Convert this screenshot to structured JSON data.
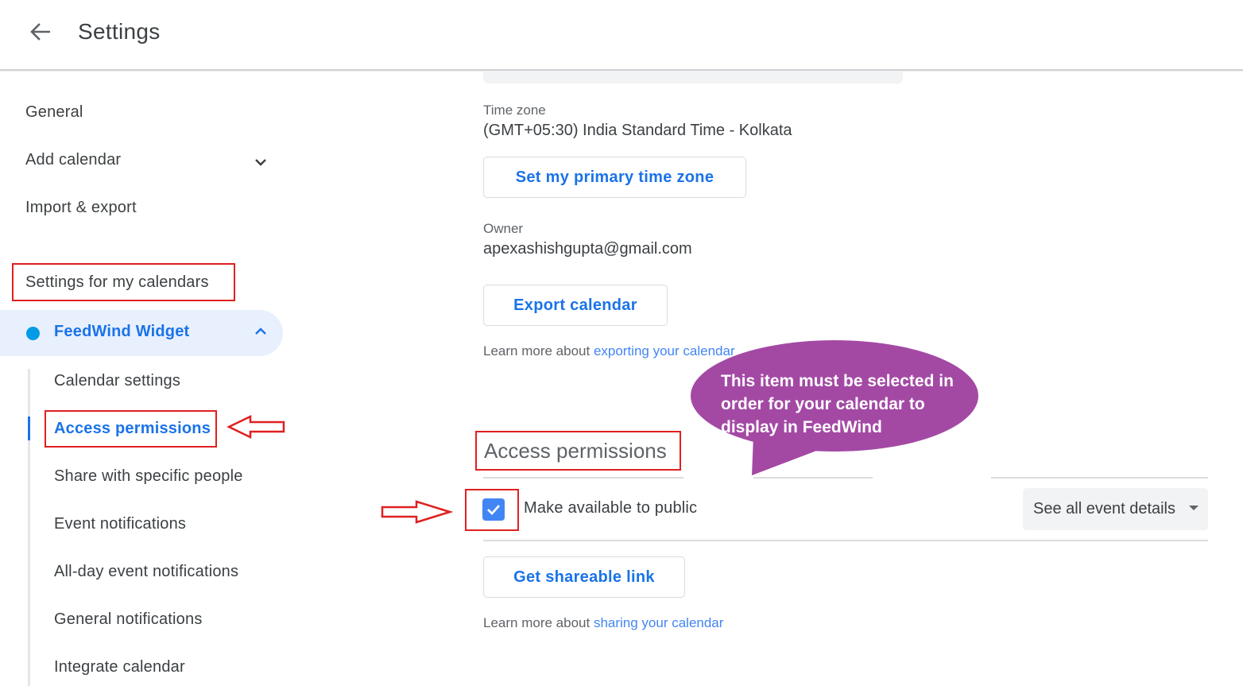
{
  "header": {
    "title": "Settings",
    "back_icon": "arrow-left-icon"
  },
  "sidebar": {
    "items": [
      {
        "label": "General"
      },
      {
        "label": "Add calendar",
        "icon": "chevron-down-icon"
      },
      {
        "label": "Import & export"
      }
    ],
    "section_heading": "Settings for my calendars",
    "calendar": {
      "name": "FeedWind Widget",
      "color": "#039be5",
      "expanded": true,
      "icon": "chevron-up-icon"
    },
    "sub_items": [
      {
        "label": "Calendar settings",
        "active": false
      },
      {
        "label": "Access permissions",
        "active": true
      },
      {
        "label": "Share with specific people",
        "active": false
      },
      {
        "label": "Event notifications",
        "active": false
      },
      {
        "label": "All-day event notifications",
        "active": false
      },
      {
        "label": "General notifications",
        "active": false
      },
      {
        "label": "Integrate calendar",
        "active": false
      }
    ]
  },
  "main": {
    "time_zone": {
      "label": "Time zone",
      "value": "(GMT+05:30) India Standard Time - Kolkata",
      "button": "Set my primary time zone"
    },
    "owner": {
      "label": "Owner",
      "value": "apexashishgupta@gmail.com"
    },
    "export": {
      "button": "Export calendar",
      "learn_prefix": "Learn more about",
      "learn_link": "exporting your calendar"
    },
    "access_permissions": {
      "heading": "Access permissions",
      "public_checkbox": {
        "label": "Make available to public",
        "checked": true
      },
      "visibility_select": {
        "value": "See all event details"
      },
      "share_button": "Get shareable link",
      "learn_prefix": "Learn more about",
      "learn_link": "sharing your calendar"
    }
  },
  "annotation": {
    "callout_text": "This item must be selected in order for your calendar to display in FeedWind",
    "callout_color": "#a349a4",
    "highlight_color": "#e02020"
  }
}
